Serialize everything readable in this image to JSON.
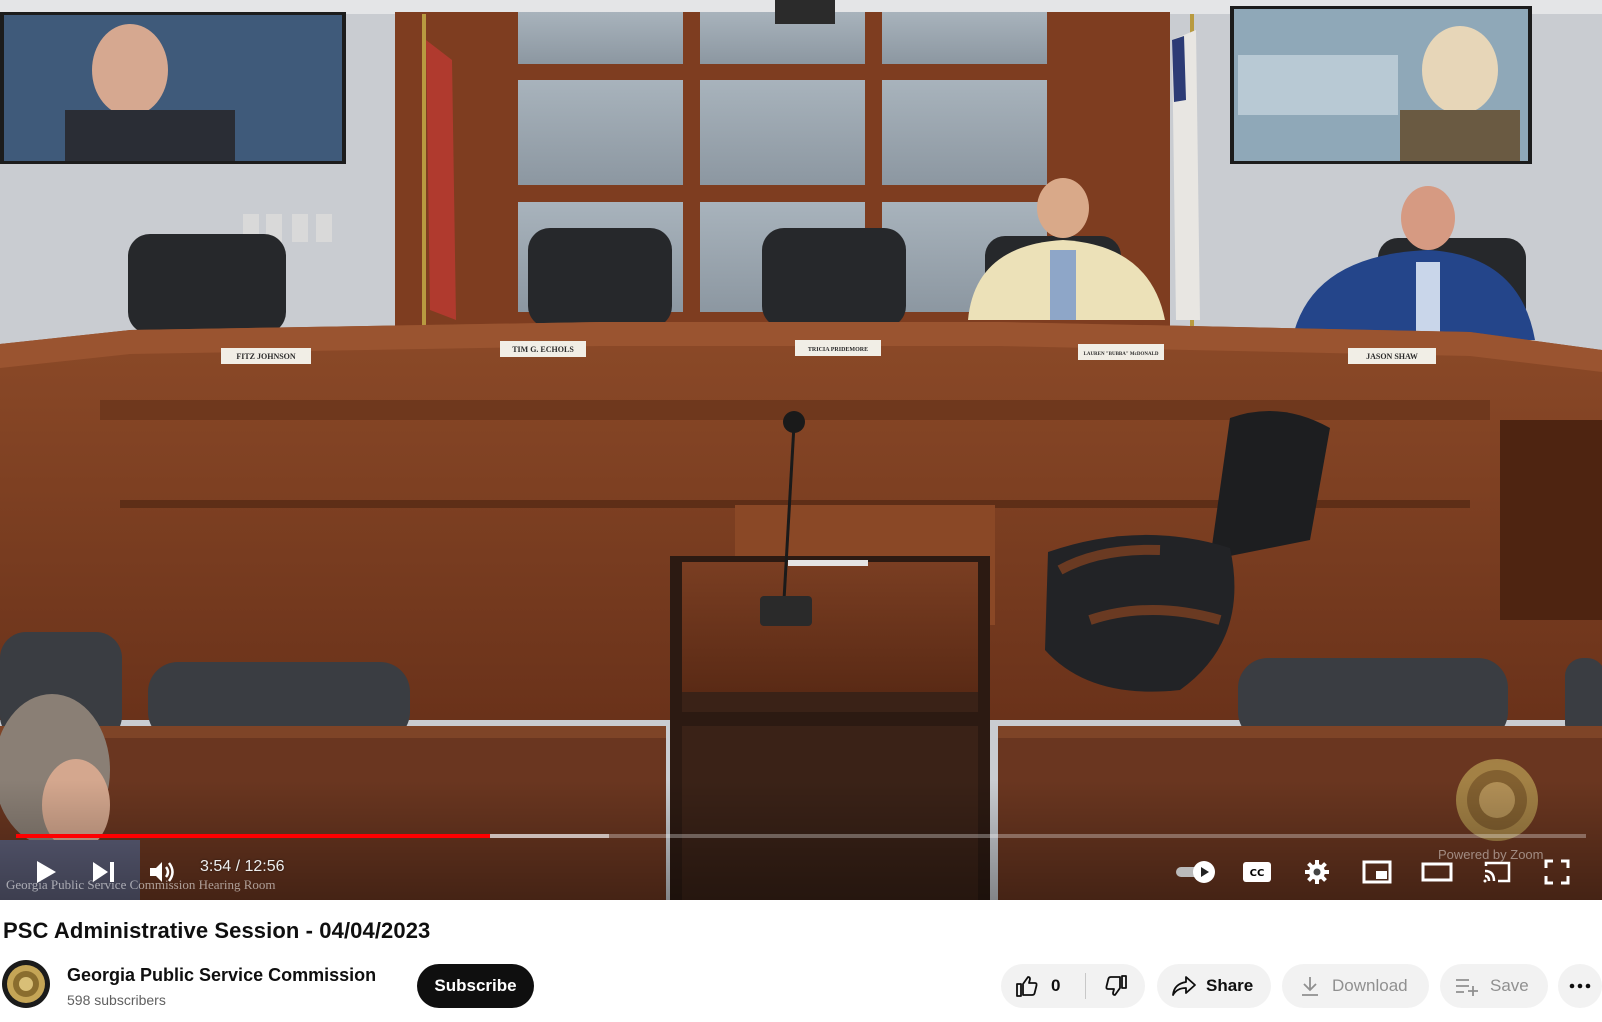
{
  "player": {
    "time_current": "3:54",
    "time_separator": "/",
    "time_total": "12:56",
    "played_fraction": 0.302,
    "buffered_fraction": 0.378,
    "room_caption": "Georgia Public Service Commission Hearing Room",
    "zoom_caption": "Powered by Zoom",
    "nameplates": [
      "FITZ JOHNSON",
      "TIM G. ECHOLS",
      "TRICIA PRIDEMORE",
      "LAUREN \"BUBBA\" McDONALD",
      "JASON SHAW"
    ],
    "controls": {
      "play_icon": "play-icon",
      "next_icon": "next-icon",
      "volume_icon": "volume-icon",
      "autoplay_icon": "autoplay-toggle-icon",
      "captions_icon": "cc-icon",
      "settings_icon": "gear-icon",
      "miniplayer_icon": "miniplayer-icon",
      "theater_icon": "theater-mode-icon",
      "cast_icon": "cast-icon",
      "fullscreen_icon": "fullscreen-icon"
    },
    "colors": {
      "progress_played": "#ff0000",
      "wood": "#7a3f22",
      "wall": "#cfd2d6"
    }
  },
  "video": {
    "title": "PSC Administrative Session - 04/04/2023"
  },
  "channel": {
    "name": "Georgia Public Service Commission",
    "subscribers": "598 subscribers",
    "subscribe_label": "Subscribe"
  },
  "actions": {
    "like_count": "0",
    "share_label": "Share",
    "download_label": "Download",
    "save_label": "Save",
    "more_icon": "more-horizontal-icon"
  },
  "colors": {
    "subscribe_bg": "#0f0f0f",
    "pill_bg": "#f2f2f2",
    "text_primary": "#0f0f0f",
    "text_secondary": "#606060"
  }
}
